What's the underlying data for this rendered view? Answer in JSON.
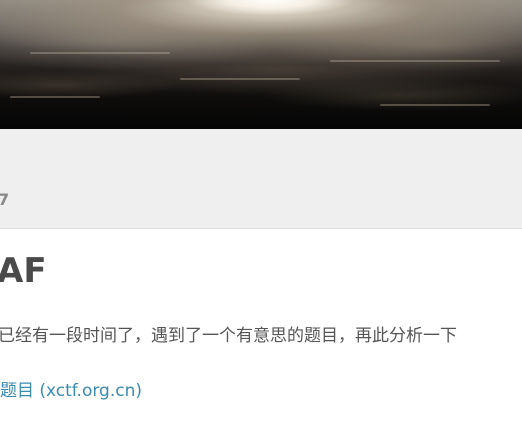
{
  "hero": {
    "image_name": "cloudscape-banner"
  },
  "meta": {
    "date_fragment": "7"
  },
  "post": {
    "title": "AF",
    "excerpt": "已经有一段时间了，遇到了一个有意思的题目，再此分析一下",
    "link_text": " 题目 (xctf.org.cn)"
  },
  "colors": {
    "link": "#3a8bb0",
    "title": "#4a4a4a",
    "meta_band": "#efefef"
  }
}
